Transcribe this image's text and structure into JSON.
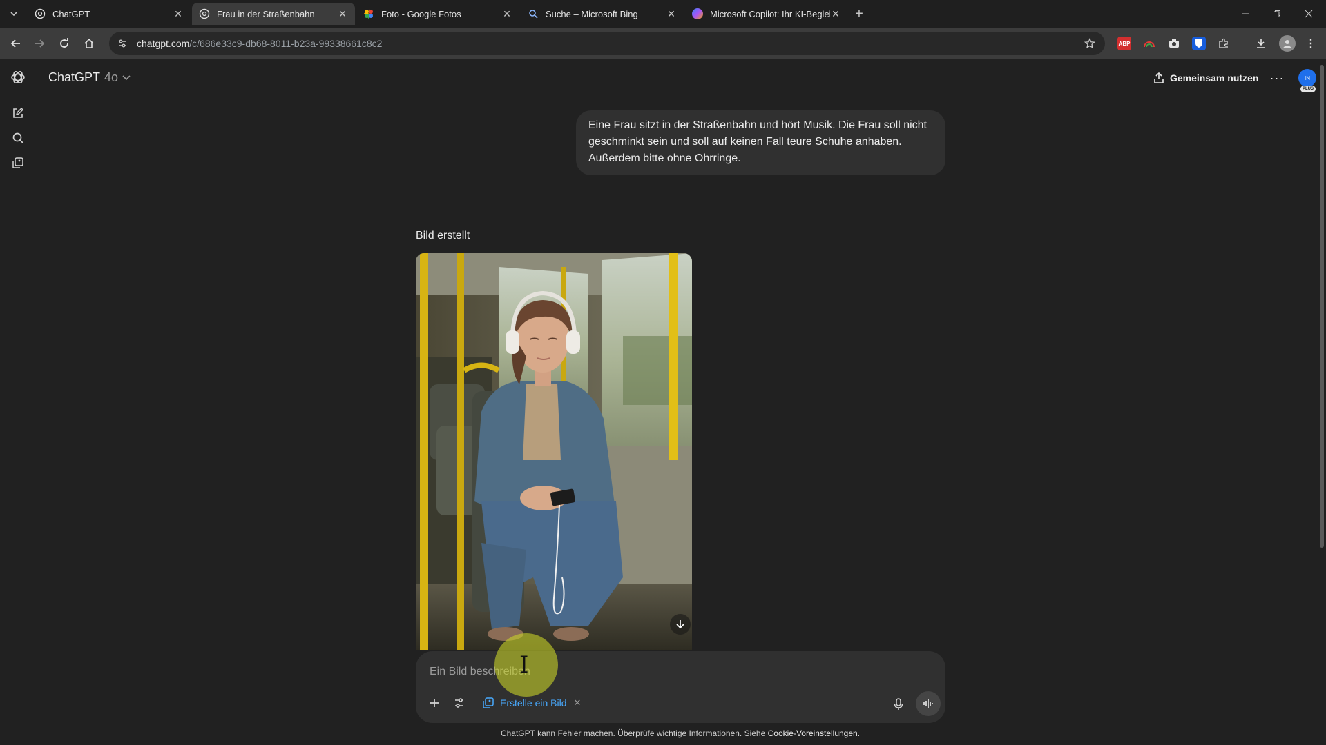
{
  "browser": {
    "tabs": [
      {
        "title": "ChatGPT",
        "icon": "chatgpt-favicon",
        "active": false
      },
      {
        "title": "Frau in der Straßenbahn",
        "icon": "chatgpt-favicon",
        "active": true
      },
      {
        "title": "Foto - Google Fotos",
        "icon": "google-photos-favicon",
        "active": false
      },
      {
        "title": "Suche – Microsoft Bing",
        "icon": "search-icon",
        "active": false
      },
      {
        "title": "Microsoft Copilot: Ihr KI-Begleit",
        "icon": "copilot-favicon",
        "active": false
      }
    ],
    "url_host": "chatgpt.com",
    "url_path": "/c/686e33c9-db68-8011-b23a-99338661c8c2",
    "extensions": [
      "abp-icon",
      "rainbow-icon",
      "camera-icon",
      "bitwarden-icon",
      "puzzle-icon"
    ],
    "colors": {
      "tabstrip": "#1f1f1f",
      "toolbar": "#3c3c3c",
      "omnibox": "#282828"
    }
  },
  "app": {
    "model_name": "ChatGPT",
    "model_version": "4o",
    "share_label": "Gemeinsam nutzen",
    "avatar_initials": "IN",
    "plan_badge": "PLUS"
  },
  "conversation": {
    "user_message": "Eine Frau sitzt in der Straßenbahn und hört Musik. Die Frau soll nicht geschminkt sein und soll auf keinen Fall teure Schuhe anhaben. Außerdem bitte ohne Ohrringe.",
    "image_label": "Bild erstellt"
  },
  "composer": {
    "placeholder": "Ein Bild beschreiben",
    "tool_chip_label": "Erstelle ein Bild"
  },
  "footer": {
    "note": "ChatGPT kann Fehler machen. Überprüfe wichtige Informationen. Siehe ",
    "link": "Cookie-Voreinstellungen",
    "end": "."
  },
  "colors": {
    "background": "#212121",
    "bubble": "#303030",
    "accent_blue": "#48aaff"
  }
}
